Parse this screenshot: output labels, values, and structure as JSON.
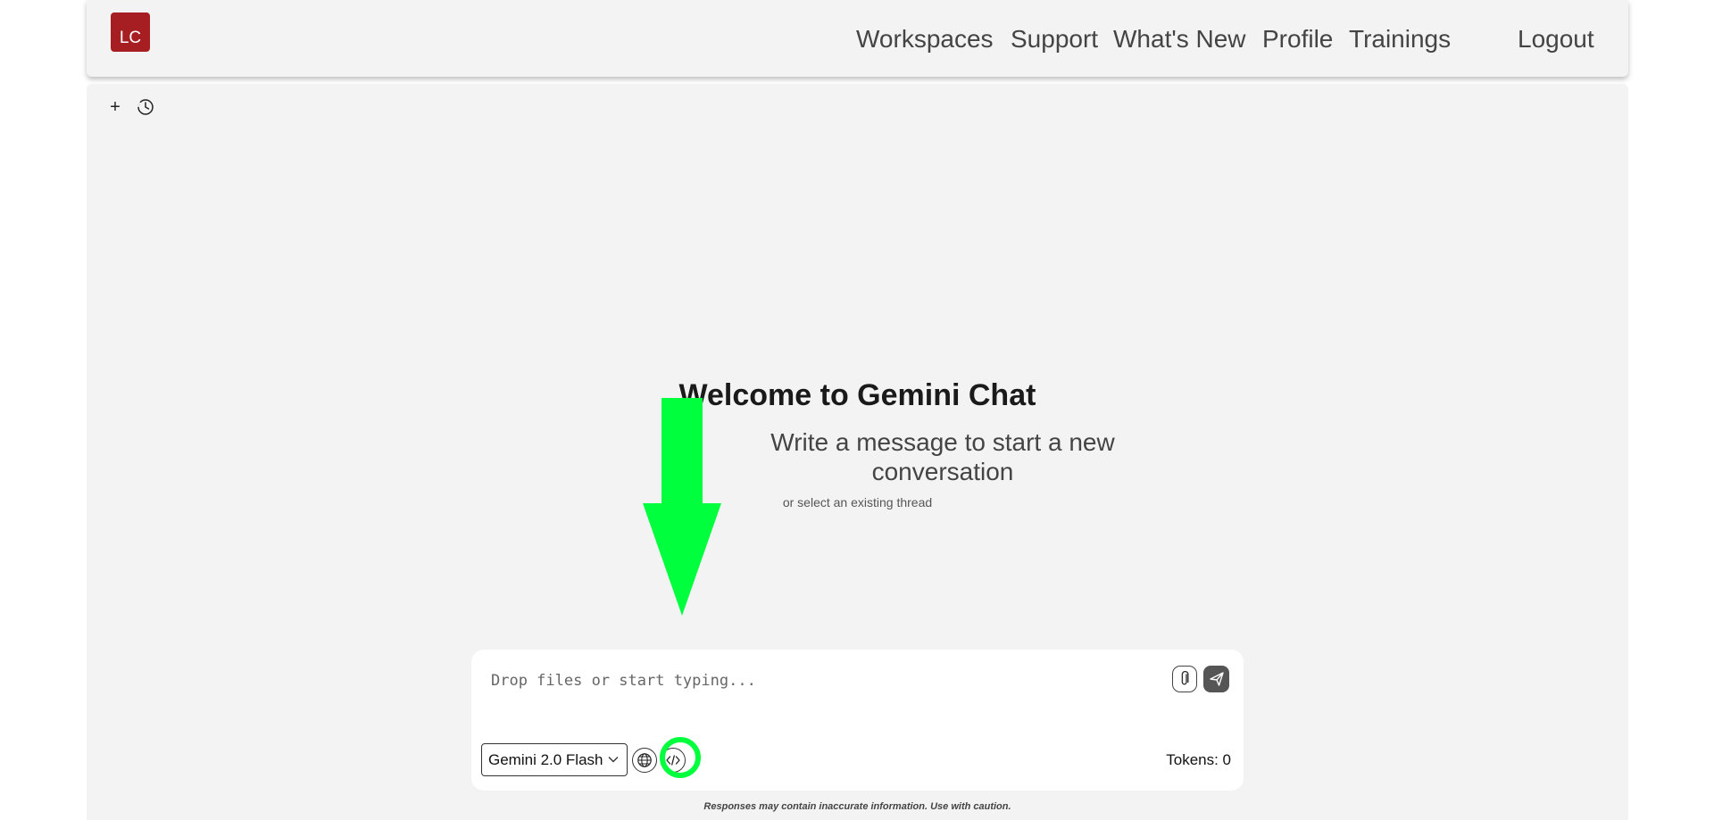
{
  "header": {
    "logo_text": "LC",
    "nav": {
      "workspaces": "Workspaces",
      "support": "Support",
      "whats_new": "What's New",
      "profile": "Profile",
      "trainings": "Trainings",
      "logout": "Logout"
    }
  },
  "toolbar": {
    "new_label": "+",
    "history_icon": "clock-icon"
  },
  "welcome": {
    "title": "Welcome to Gemini Chat",
    "subtitle": "Write a message to start a new conversation",
    "hint": "or select an existing thread"
  },
  "composer": {
    "placeholder": "Drop files or start typing...",
    "value": "",
    "attach_icon": "paperclip-icon",
    "send_icon": "send-icon",
    "model_selected": "Gemini 2.0 Flash",
    "globe_icon": "globe-icon",
    "code_icon": "code-icon",
    "tokens_label": "Tokens: 0"
  },
  "disclaimer": "Responses may contain inaccurate information. Use with caution.",
  "colors": {
    "brand": "#a61e22",
    "panel_bg": "#f3f3f3",
    "annotation": "#00ff3c"
  }
}
